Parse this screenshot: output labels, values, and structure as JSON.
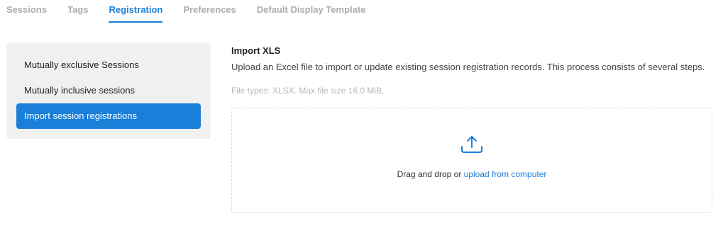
{
  "tabs": [
    {
      "label": "Sessions"
    },
    {
      "label": "Tags"
    },
    {
      "label": "Registration"
    },
    {
      "label": "Preferences"
    },
    {
      "label": "Default Display Template"
    }
  ],
  "active_tab": "Registration",
  "sidebar": {
    "items": [
      {
        "label": "Mutually exclusive Sessions"
      },
      {
        "label": "Mutually inclusive sessions"
      },
      {
        "label": "Import session registrations"
      }
    ],
    "active_item": "Import session registrations"
  },
  "main": {
    "heading": "Import XLS",
    "description": "Upload an Excel file to import or update existing session registration records. This process consists of several steps.",
    "file_types": "File types: XLSX. Max file size 16.0 MiB.",
    "dropzone": {
      "icon": "upload-icon",
      "prefix_text": "Drag and drop or ",
      "link_text": "upload from computer"
    }
  },
  "colors": {
    "accent": "#1a7fd9",
    "sidebar_bg": "#f0f0f0",
    "muted_text": "#a7adb3"
  }
}
